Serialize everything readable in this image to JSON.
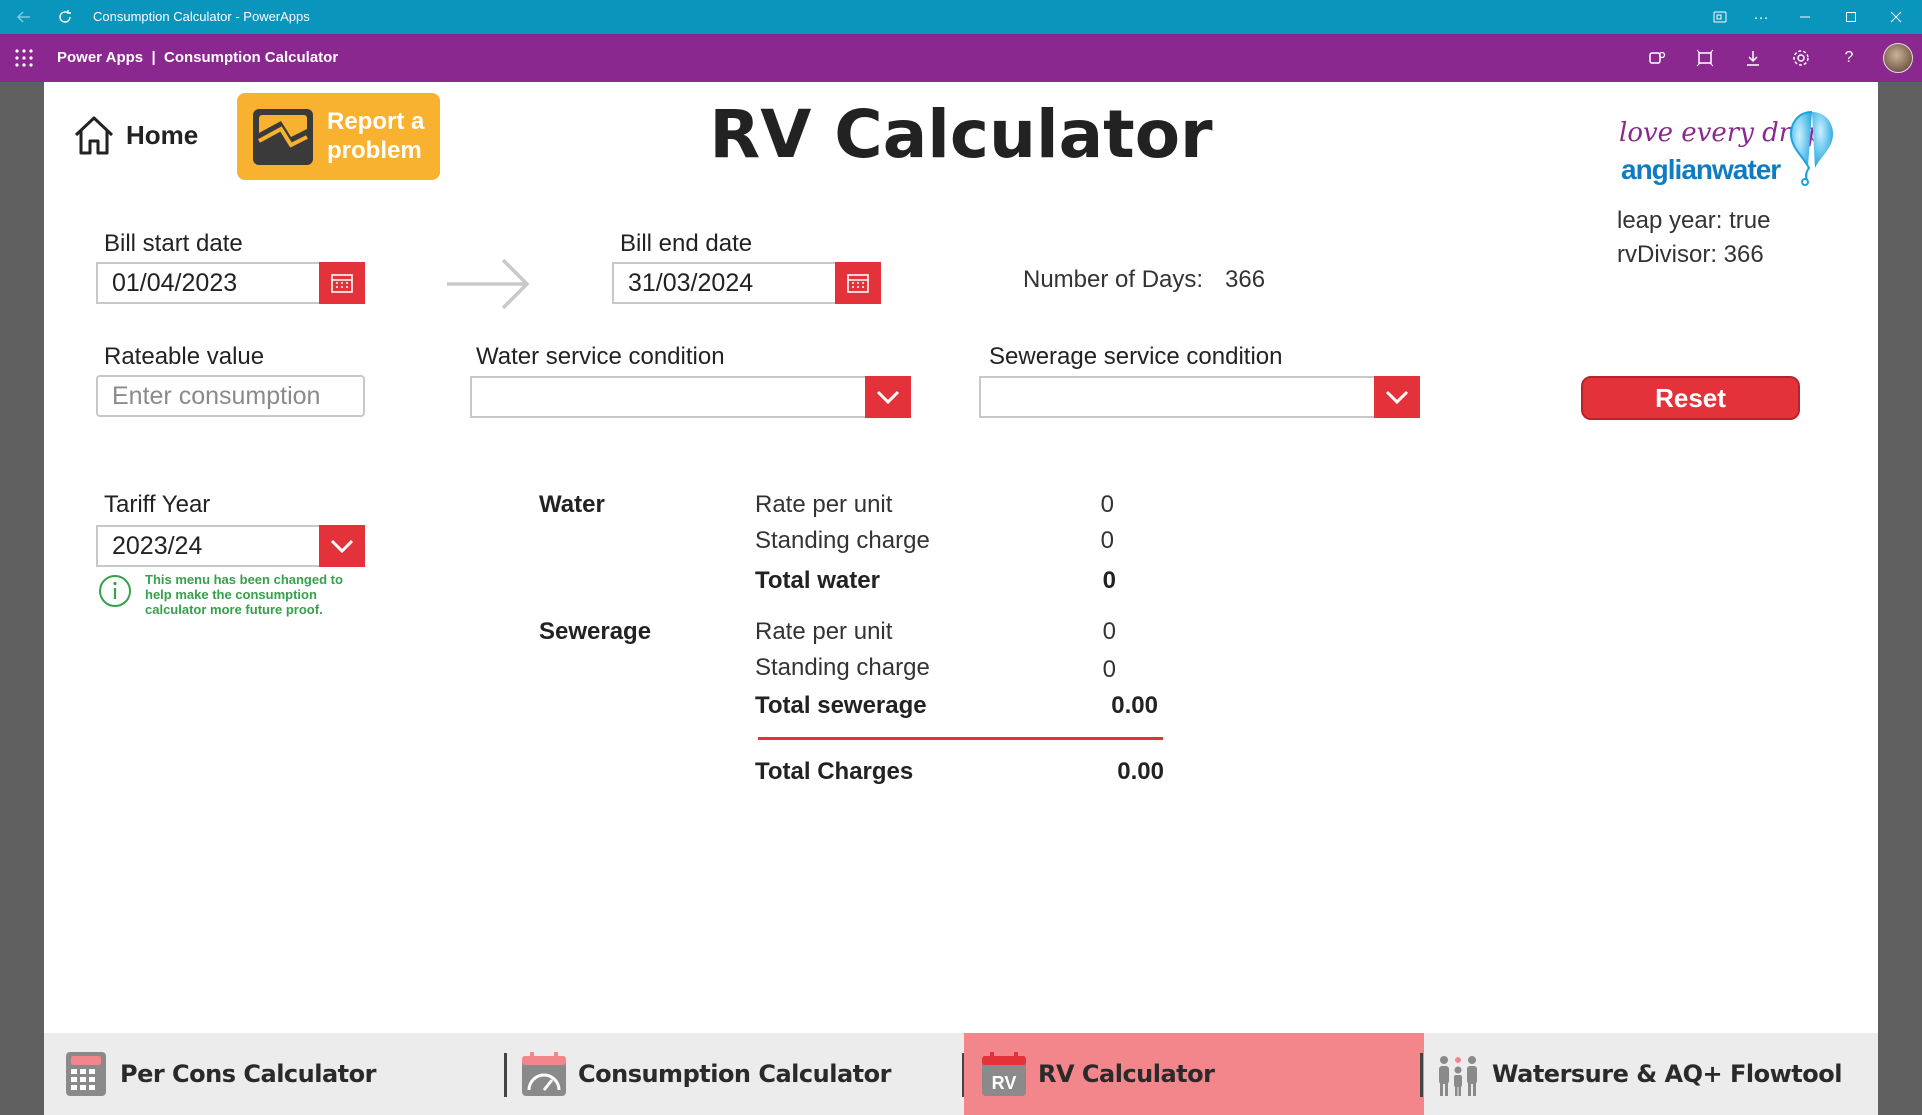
{
  "window": {
    "title": "Consumption Calculator - PowerApps"
  },
  "appbar": {
    "brand": "Power Apps  |  Consumption Calculator"
  },
  "header": {
    "home_label": "Home",
    "report_label": "Report a problem",
    "page_title": "RV Calculator",
    "logo_tagline": "love every drop",
    "logo_name": "anglianwater",
    "leap_year": "leap year: true",
    "rv_divisor": "rvDivisor: 366"
  },
  "form": {
    "bill_start_label": "Bill start date",
    "bill_start_value": "01/04/2023",
    "bill_end_label": "Bill end date",
    "bill_end_value": "31/03/2024",
    "days_label": "Number of Days:",
    "days_value": "366",
    "rateable_label": "Rateable value",
    "rateable_placeholder": "Enter consumption",
    "water_cond_label": "Water service condition",
    "water_cond_value": "",
    "sewer_cond_label": "Sewerage service condition",
    "sewer_cond_value": "",
    "reset_label": "Reset",
    "tariff_label": "Tariff Year",
    "tariff_value": "2023/24",
    "tariff_note": "This menu has been changed to help make the consumption calculator more future proof."
  },
  "results": {
    "water_title": "Water",
    "sewerage_title": "Sewerage",
    "rate_label": "Rate per unit",
    "standing_label": "Standing charge",
    "water_rate": "0",
    "water_standing": "0",
    "total_water_label": "Total water",
    "total_water": "0",
    "sewer_rate": "0",
    "sewer_standing": "0",
    "total_sewer_label": "Total sewerage",
    "total_sewer": "0.00",
    "total_charges_label": "Total Charges",
    "total_charges": "0.00"
  },
  "nav": {
    "items": [
      {
        "label": "Per Cons Calculator",
        "active": false
      },
      {
        "label": "Consumption Calculator",
        "active": false
      },
      {
        "label": "RV Calculator",
        "active": true
      },
      {
        "label": "Watersure & AQ+ Flowtool",
        "active": false
      }
    ]
  },
  "colors": {
    "titlebar": "#0a95bd",
    "appbar": "#8b288f",
    "accent_red": "#e3323a",
    "report_orange": "#f9b230",
    "nav_active": "#f2868b",
    "info_green": "#36a04b"
  }
}
